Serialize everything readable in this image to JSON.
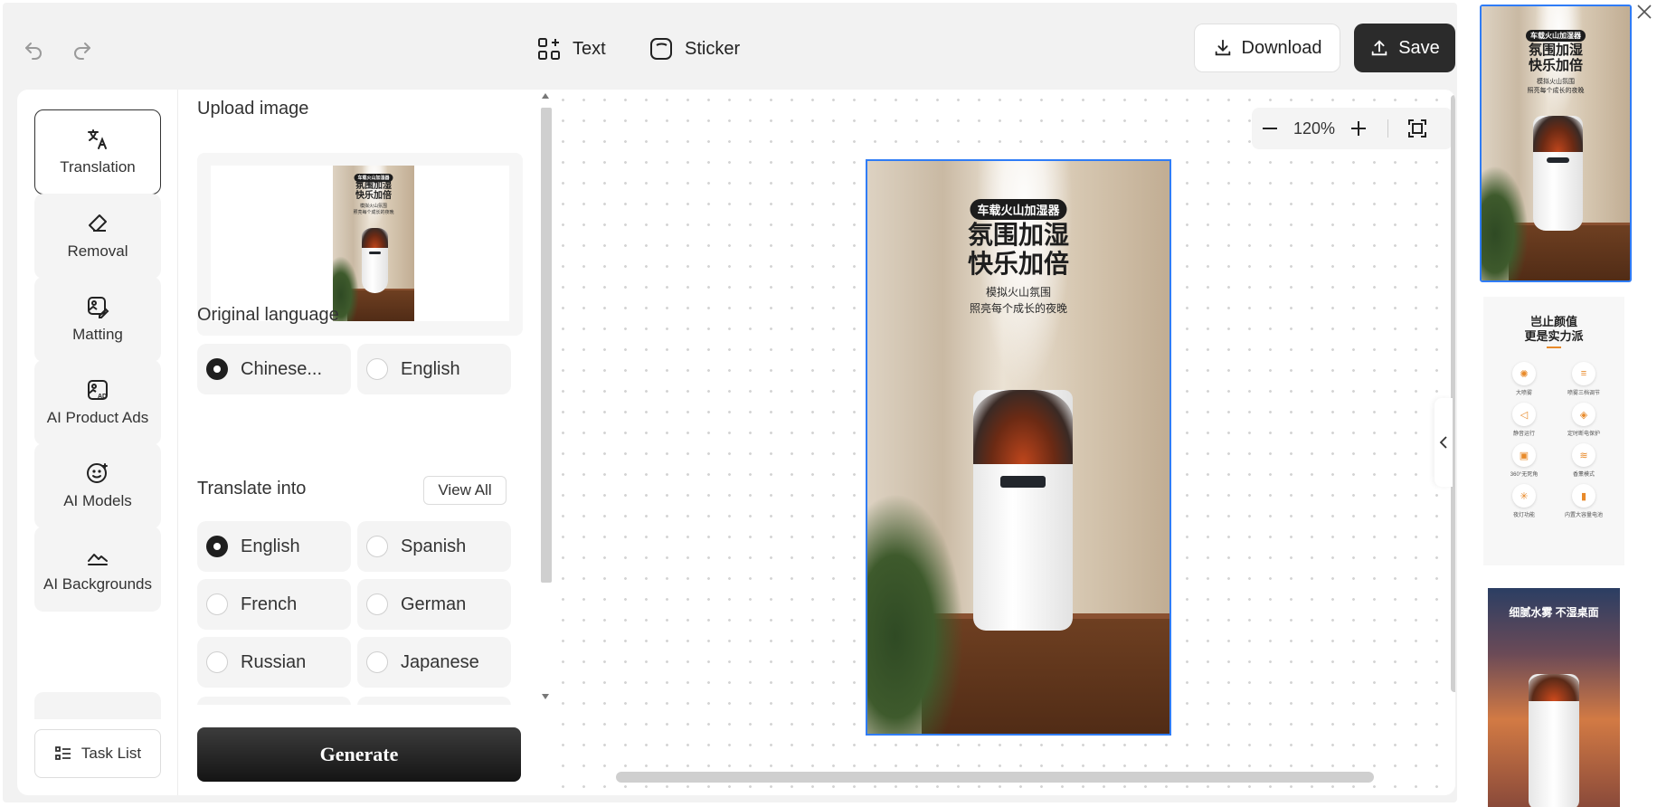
{
  "toolbar": {
    "text_label": "Text",
    "sticker_label": "Sticker",
    "download_label": "Download",
    "save_label": "Save"
  },
  "sidebar": {
    "items": [
      {
        "label": "Translation",
        "icon": "translate-icon",
        "active": true
      },
      {
        "label": "Removal",
        "icon": "eraser-icon",
        "active": false
      },
      {
        "label": "Matting",
        "icon": "image-edit-icon",
        "active": false
      },
      {
        "label": "AI Product Ads",
        "icon": "ad-image-icon",
        "active": false
      },
      {
        "label": "AI Models",
        "icon": "model-face-icon",
        "active": false
      },
      {
        "label": "AI Backgrounds",
        "icon": "landscape-icon",
        "active": false
      }
    ],
    "task_list_label": "Task List"
  },
  "panel": {
    "upload_title": "Upload image",
    "original_language_title": "Original language",
    "original_options": [
      {
        "label": "Chinese...",
        "checked": true
      },
      {
        "label": "English",
        "checked": false
      }
    ],
    "translate_title": "Translate into",
    "view_all_label": "View All",
    "target_options": [
      {
        "label": "English",
        "checked": true
      },
      {
        "label": "Spanish",
        "checked": false
      },
      {
        "label": "French",
        "checked": false
      },
      {
        "label": "German",
        "checked": false
      },
      {
        "label": "Russian",
        "checked": false
      },
      {
        "label": "Japanese",
        "checked": false
      }
    ],
    "generate_label": "Generate"
  },
  "canvas": {
    "zoom": "120%"
  },
  "poster": {
    "tag": "车载火山加湿器",
    "headline_1": "氛围加湿",
    "headline_2": "快乐加倍",
    "sub_1": "模拟火山氛围",
    "sub_2": "照亮每个成长的夜晚"
  },
  "thumb2": {
    "title_1": "岂止颜值",
    "title_2": "更是实力派",
    "features": [
      "大喷雾",
      "喷雾三档调节",
      "静音运行",
      "定时断电保护",
      "360°无死角",
      "香薰模式",
      "夜灯功能",
      "内置大容量电池"
    ]
  },
  "thumb3": {
    "title": "细腻水雾 不湿桌面"
  },
  "colors": {
    "accent": "#2f7cf6",
    "dark_button": "#2b2b2b"
  }
}
